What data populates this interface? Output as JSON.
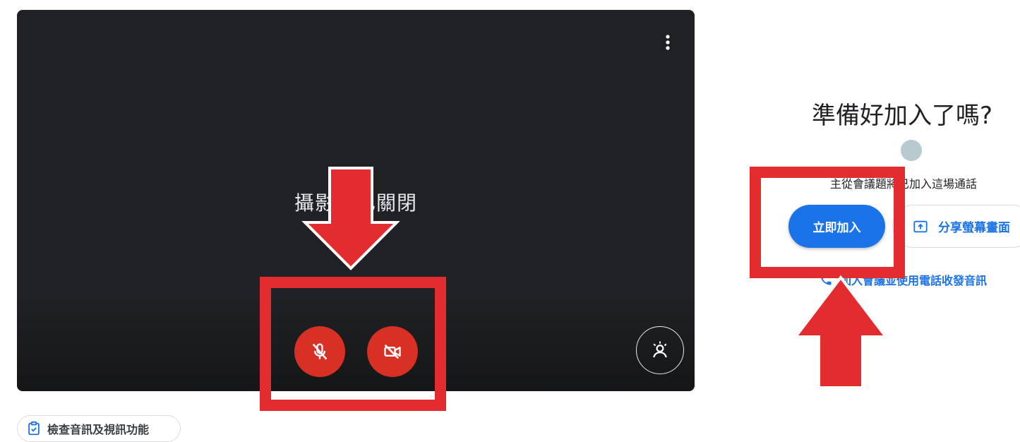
{
  "preview": {
    "camera_off_text": "攝影機已關閉",
    "more_icon": "more-vert-icon",
    "mic_icon": "mic-off-icon",
    "camera_icon": "videocam-off-icon",
    "effects_icon": "visual-effects-icon",
    "accent_color": "#d93025"
  },
  "check_av": {
    "label": "檢查音訊及視訊功能",
    "icon": "clipboard-check-icon"
  },
  "join_panel": {
    "title": "準備好加入了嗎?",
    "status": "主從會議題將已加入這場通話",
    "join_button": "立即加入",
    "present_button": "分享螢幕畫面",
    "present_icon": "present-to-all-icon",
    "phone_link": "加入會議並使用電話收發音訊",
    "phone_icon": "phone-icon",
    "accent_color": "#1a73e8"
  },
  "annotations": {
    "color": "#e32c2f",
    "arrow_down": "arrow-down",
    "arrow_up": "arrow-up"
  }
}
